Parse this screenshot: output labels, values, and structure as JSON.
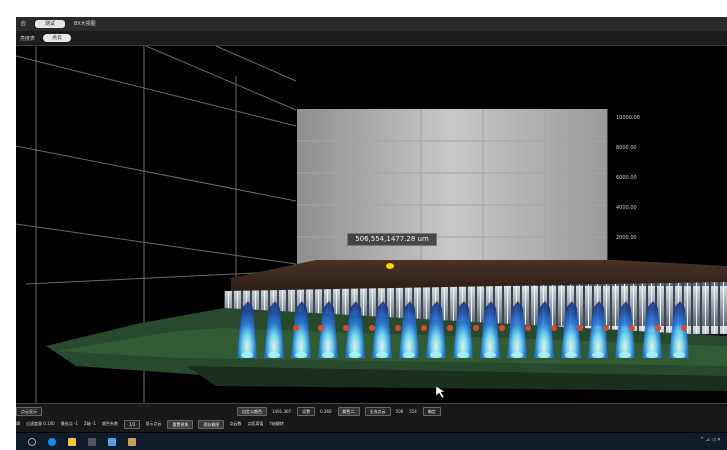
{
  "top_menu": [
    {
      "label": "应",
      "active": false
    },
    {
      "label": "测试",
      "active": true
    },
    {
      "label": "8X大视图",
      "active": false
    }
  ],
  "sub_menu": {
    "left_label": "亮度表",
    "pill_label": "点云"
  },
  "view": {
    "axis_labels": [
      "10000.00",
      "8000.00",
      "6000.00",
      "4000.00",
      "2000.00"
    ],
    "tooltip": "506,554,1477.28 um"
  },
  "bottom_bar": {
    "row1": {
      "left_label": "点云显示",
      "field1": "自定义颜色",
      "value1": "1491.307",
      "btn_set": "设置",
      "value2": "0.360",
      "dropdown1": "颜色二",
      "btn_all": "全选点云",
      "value3": "506",
      "value4": "554",
      "btn_confirm": "确定"
    },
    "row2": {
      "f1": "阈",
      "f2": "过滤度量 0.100",
      "f3": "最低点 -1",
      "f4": "Z轴 -1",
      "f5": "颜色系数",
      "dropdown": "1/2",
      "check1": "显示点云",
      "btn_reset": "重置视角",
      "btn_save": "保存截图",
      "f6": "点云数",
      "f7": "点距离值",
      "f8": "Y轴翻转"
    }
  },
  "taskbar": {
    "icons": [
      "start-icon",
      "edge-icon",
      "file-explorer-icon",
      "app-icon",
      "settings-icon",
      "folder-icon"
    ],
    "tray": "^ ⊿ ◁ ✕"
  }
}
